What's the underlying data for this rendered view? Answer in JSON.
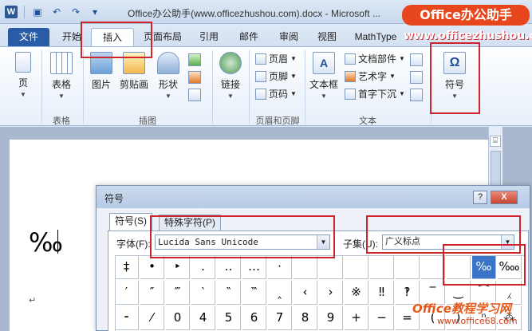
{
  "window": {
    "title": "Office办公助手(www.officezhushou.com).docx - Microsoft ..."
  },
  "quick_access": {
    "app_icon": "word-logo",
    "app_letter": "W",
    "save_icon": "save-icon",
    "undo_icon": "undo-icon",
    "redo_icon": "redo-icon",
    "customize_icon": "customize-icon"
  },
  "watermarks": {
    "badge": "Office办公助手",
    "site": "www.officezhushou.com",
    "bottom": "Office教程学习网",
    "bottom_url": "www.office68.com"
  },
  "ribbon_tabs": [
    "文件",
    "开始",
    "插入",
    "页面布局",
    "引用",
    "邮件",
    "审阅",
    "视图",
    "MathType"
  ],
  "ribbon": {
    "groups": [
      "表格",
      "插图",
      "页眉和页脚",
      "文本"
    ],
    "page_btn": "页",
    "table_btn": "表格",
    "picture_btn": "图片",
    "clipart_btn": "剪贴画",
    "shapes_btn": "形状",
    "link_btn": "链接",
    "header_btn": "页眉",
    "footer_btn": "页脚",
    "pagenum_btn": "页码",
    "textbox_btn": "文本框",
    "docparts_btn": "文档部件",
    "wordart_btn": "艺术字",
    "dropcap_btn": "首字下沉",
    "symbol_btn": "符号",
    "symbol_glyph": "Ω"
  },
  "document": {
    "text": "‰",
    "return_mark": "↵"
  },
  "dialog": {
    "title": "符号",
    "help": "?",
    "close": "X",
    "tabs": [
      "符号(S)",
      "特殊字符(P)"
    ],
    "font_label": "字体(F):",
    "font_value": "Lucida Sans Unicode",
    "subset_label": "子集(U):",
    "subset_value": "广义标点",
    "symbols_row1": [
      "‡",
      "•",
      "‣",
      "․",
      "‥",
      "…",
      "‧",
      "",
      "",
      "",
      "",
      "",
      "",
      "",
      "‰",
      "‱"
    ],
    "symbols_row2": [
      "′",
      "″",
      "‴",
      "‵",
      "‶",
      "‷",
      "‸",
      "‹",
      "›",
      "※",
      "‼",
      "‽",
      "‾",
      "‿",
      "⁀",
      "⁁"
    ],
    "symbols_row3": [
      "⁃",
      "⁄",
      "0",
      "4",
      "5",
      "6",
      "7",
      "8",
      "9",
      "+",
      "−",
      "=",
      "(",
      ")",
      "ⁿ",
      "⁂"
    ],
    "selected_symbol": "‰"
  }
}
